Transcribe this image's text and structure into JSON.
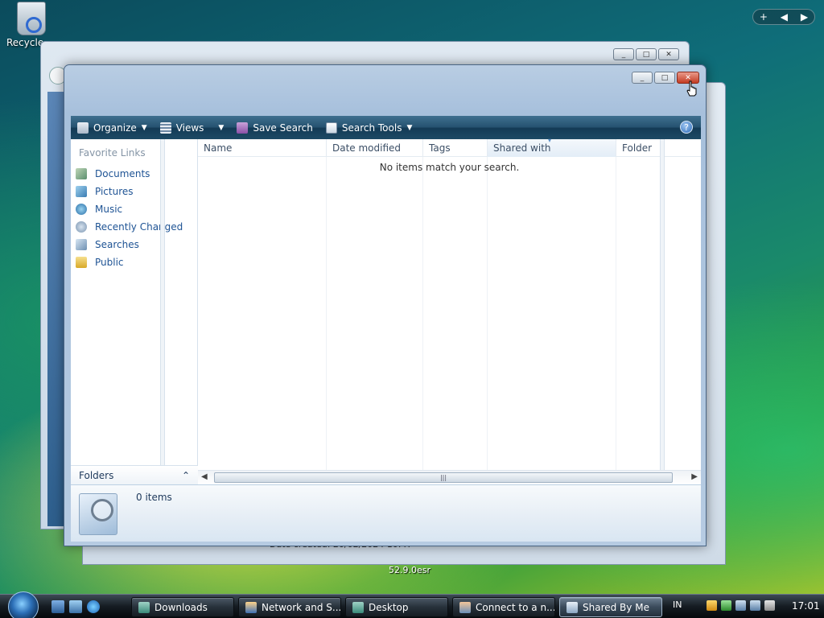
{
  "desktop": {
    "recycle_label": "Recycle",
    "gadget_controls": [
      "+",
      "◀",
      "▶"
    ],
    "background_text": "52.9.0esr",
    "back_window_status": "Date created: 20/02/2024 10:47"
  },
  "window": {
    "controls": {
      "minimize": "_",
      "maximize": "□",
      "close": "✕"
    },
    "toolbar": {
      "organize": "Organize",
      "views": "Views",
      "save_search": "Save Search",
      "search_tools": "Search Tools",
      "help": "?"
    },
    "nav": {
      "title": "Favorite Links",
      "items": [
        {
          "label": "Documents",
          "icon": "documents-icon"
        },
        {
          "label": "Pictures",
          "icon": "pictures-icon"
        },
        {
          "label": "Music",
          "icon": "music-icon"
        },
        {
          "label": "Recently Changed",
          "icon": "recently-changed-icon"
        },
        {
          "label": "Searches",
          "icon": "searches-icon"
        },
        {
          "label": "Public",
          "icon": "public-folder-icon"
        }
      ],
      "folders_label": "Folders",
      "folders_toggle": "⌃"
    },
    "columns": [
      "Name",
      "Date modified",
      "Tags",
      "Shared with",
      "Folder"
    ],
    "empty_message": "No items match your search.",
    "scroll": {
      "left": "◀",
      "right": "▶",
      "thumb": "|||"
    },
    "details": {
      "count": "0 items"
    }
  },
  "taskbar": {
    "buttons": [
      {
        "label": "Downloads",
        "active": false
      },
      {
        "label": "Network and S...",
        "active": false
      },
      {
        "label": "Desktop",
        "active": false
      },
      {
        "label": "Connect to a n...",
        "active": false
      },
      {
        "label": "Shared By Me",
        "active": true
      }
    ],
    "language": "IN",
    "clock": "17:01"
  }
}
